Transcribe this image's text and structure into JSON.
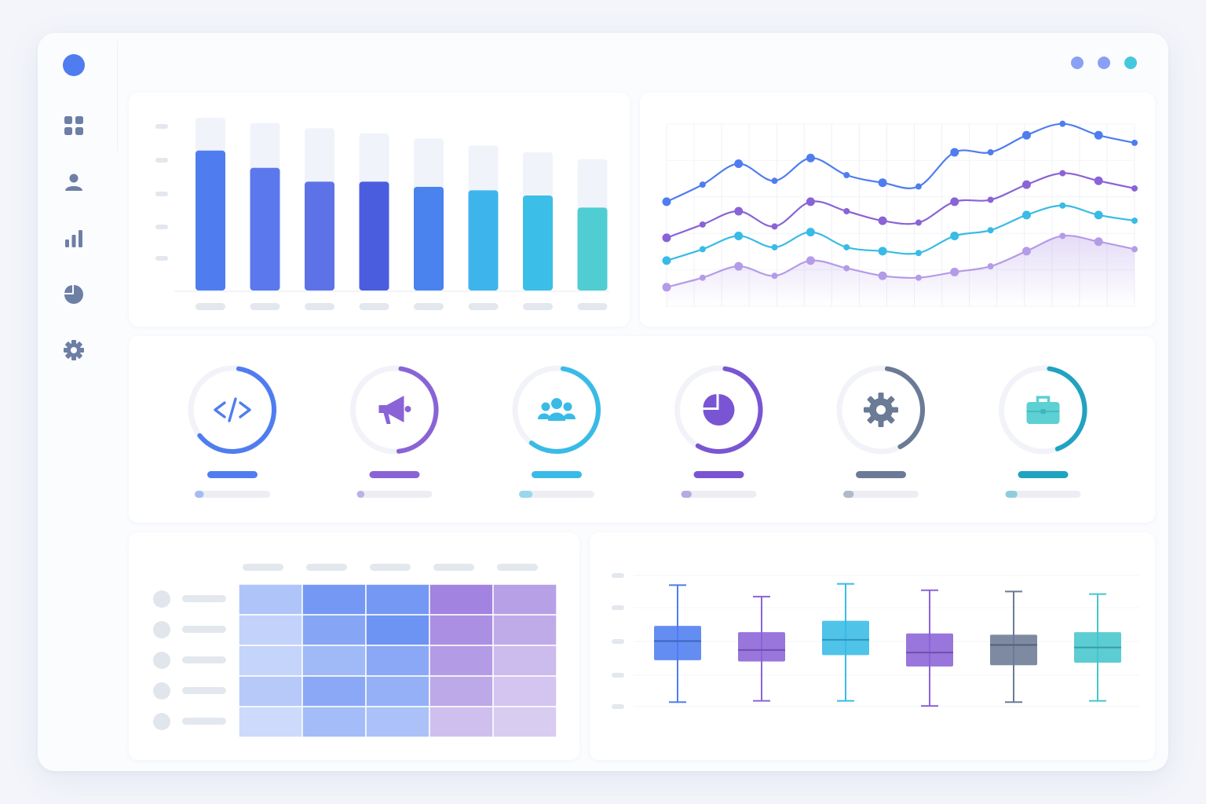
{
  "app": {
    "logo_color": "#4f7df0",
    "window_dots": [
      {
        "name": "dot-1",
        "color": "#8aa0f5"
      },
      {
        "name": "dot-2",
        "color": "#8aa0f5"
      },
      {
        "name": "dot-3",
        "color": "#45c8dc"
      }
    ]
  },
  "sidebar": {
    "items": [
      {
        "icon": "grid-icon",
        "active": true
      },
      {
        "icon": "user-icon",
        "active": false
      },
      {
        "icon": "bar-chart-icon",
        "active": false
      },
      {
        "icon": "pie-chart-icon",
        "active": false
      },
      {
        "icon": "gear-icon",
        "active": false
      }
    ]
  },
  "colors": {
    "blue": "#4f7df0",
    "indigo": "#5b68e8",
    "purple": "#8a63d6",
    "cyan": "#38bbe6",
    "teal": "#4fcdd3",
    "slate": "#6b7a95",
    "ocean": "#1fa3c0"
  },
  "chart_data": [
    {
      "type": "bar",
      "categories": [],
      "values": [
        0.81,
        0.71,
        0.63,
        0.63,
        0.6,
        0.58,
        0.55,
        0.48
      ],
      "background_values": [
        1.0,
        0.97,
        0.94,
        0.91,
        0.88,
        0.84,
        0.8,
        0.76
      ],
      "bar_colors": [
        "#4f7df0",
        "#5b78ec",
        "#5e72e8",
        "#4b5ddf",
        "#4a82ee",
        "#3eb4ec",
        "#3bbfe8",
        "#4fcdd3"
      ],
      "title": "",
      "xlabel": "",
      "ylabel": "",
      "grid": false
    },
    {
      "type": "line",
      "x": [
        0,
        1,
        2,
        3,
        4,
        5,
        6,
        7,
        8,
        9,
        10,
        11,
        12,
        13
      ],
      "series": [
        {
          "color": "#4f7df0",
          "values": [
            0.55,
            0.64,
            0.75,
            0.66,
            0.78,
            0.69,
            0.65,
            0.63,
            0.81,
            0.81,
            0.9,
            0.96,
            0.9,
            0.86
          ]
        },
        {
          "color": "#8a63d6",
          "values": [
            0.36,
            0.43,
            0.5,
            0.42,
            0.55,
            0.5,
            0.45,
            0.44,
            0.55,
            0.56,
            0.64,
            0.7,
            0.66,
            0.62
          ]
        },
        {
          "color": "#38bbe6",
          "values": [
            0.24,
            0.3,
            0.37,
            0.31,
            0.39,
            0.31,
            0.29,
            0.28,
            0.37,
            0.4,
            0.48,
            0.53,
            0.48,
            0.45
          ]
        },
        {
          "color": "#b49be8",
          "values": [
            0.1,
            0.15,
            0.21,
            0.16,
            0.24,
            0.2,
            0.16,
            0.15,
            0.18,
            0.21,
            0.29,
            0.37,
            0.34,
            0.3
          ]
        }
      ],
      "title": "",
      "xlabel": "",
      "ylabel": "",
      "grid": true
    },
    {
      "type": "heatmap",
      "rows": 5,
      "cols": 5,
      "values": [
        [
          0.3,
          0.62,
          0.62,
          0.62,
          0.45
        ],
        [
          0.2,
          0.52,
          0.66,
          0.55,
          0.38
        ],
        [
          0.18,
          0.38,
          0.5,
          0.48,
          0.28
        ],
        [
          0.26,
          0.5,
          0.44,
          0.4,
          0.22
        ],
        [
          0.14,
          0.36,
          0.32,
          0.26,
          0.18
        ]
      ],
      "col_hues": [
        "blue",
        "blue",
        "blue",
        "purple",
        "purple"
      ]
    },
    {
      "type": "box",
      "boxes": [
        {
          "color": "#4f7df0",
          "min": 0.06,
          "q1": 0.39,
          "median": 0.54,
          "q3": 0.66,
          "max": 0.98
        },
        {
          "color": "#8a63d6",
          "min": 0.07,
          "q1": 0.38,
          "median": 0.47,
          "q3": 0.61,
          "max": 0.89
        },
        {
          "color": "#38bbe6",
          "min": 0.07,
          "q1": 0.43,
          "median": 0.55,
          "q3": 0.7,
          "max": 0.99
        },
        {
          "color": "#8a63d6",
          "min": 0.03,
          "q1": 0.34,
          "median": 0.45,
          "q3": 0.6,
          "max": 0.94
        },
        {
          "color": "#6b7a95",
          "min": 0.06,
          "q1": 0.35,
          "median": 0.51,
          "q3": 0.59,
          "max": 0.93
        },
        {
          "color": "#45c6cc",
          "min": 0.07,
          "q1": 0.37,
          "median": 0.49,
          "q3": 0.61,
          "max": 0.91
        }
      ],
      "grid": true
    }
  ],
  "categories": [
    {
      "icon": "code-icon",
      "color": "#4f7df0",
      "ring_progress": 0.62,
      "progress": 0.12
    },
    {
      "icon": "megaphone-icon",
      "color": "#8a63d6",
      "ring_progress": 0.46,
      "progress": 0.1
    },
    {
      "icon": "team-icon",
      "color": "#38bbe6",
      "ring_progress": 0.58,
      "progress": 0.18
    },
    {
      "icon": "pie-chart-icon",
      "color": "#7a55d3",
      "ring_progress": 0.56,
      "progress": 0.14
    },
    {
      "icon": "gear-icon",
      "color": "#6b7a95",
      "ring_progress": 0.4,
      "progress": 0.14
    },
    {
      "icon": "briefcase-icon",
      "color": "#1fa3c0",
      "ring_progress": 0.42,
      "progress": 0.16
    }
  ]
}
